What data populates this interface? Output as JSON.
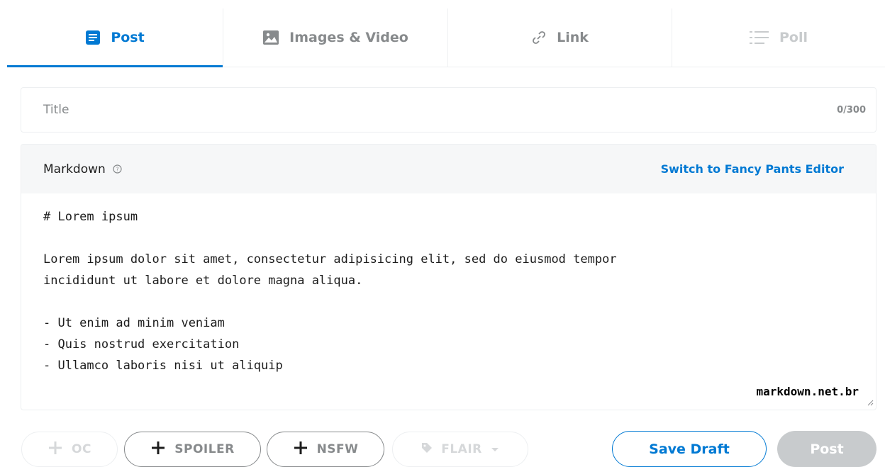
{
  "tabs": [
    {
      "label": "Post",
      "icon": "post-icon",
      "active": true
    },
    {
      "label": "Images & Video",
      "icon": "image-icon"
    },
    {
      "label": "Link",
      "icon": "link-icon"
    },
    {
      "label": "Poll",
      "icon": "poll-icon",
      "disabled": true
    }
  ],
  "title_field": {
    "placeholder": "Title",
    "value": "",
    "counter": "0/300"
  },
  "editor": {
    "mode_label": "Markdown",
    "switch_label": "Switch to Fancy Pants Editor",
    "content": "# Lorem ipsum\n\nLorem ipsum dolor sit amet, consectetur adipisicing elit, sed do eiusmod tempor\nincididunt ut labore et dolore magna aliqua.\n\n- Ut enim ad minim veniam\n- Quis nostrud exercitation\n- Ullamco laboris nisi ut aliquip",
    "watermark": "markdown.net.br"
  },
  "tags": {
    "oc": "OC",
    "spoiler": "SPOILER",
    "nsfw": "NSFW",
    "flair": "FLAIR"
  },
  "actions": {
    "save_draft": "Save Draft",
    "post": "Post"
  },
  "colors": {
    "accent": "#0079d3",
    "muted": "#878a8c",
    "disabled": "#c8cbcd",
    "border": "#edeff1",
    "header_bg": "#f6f7f8"
  }
}
